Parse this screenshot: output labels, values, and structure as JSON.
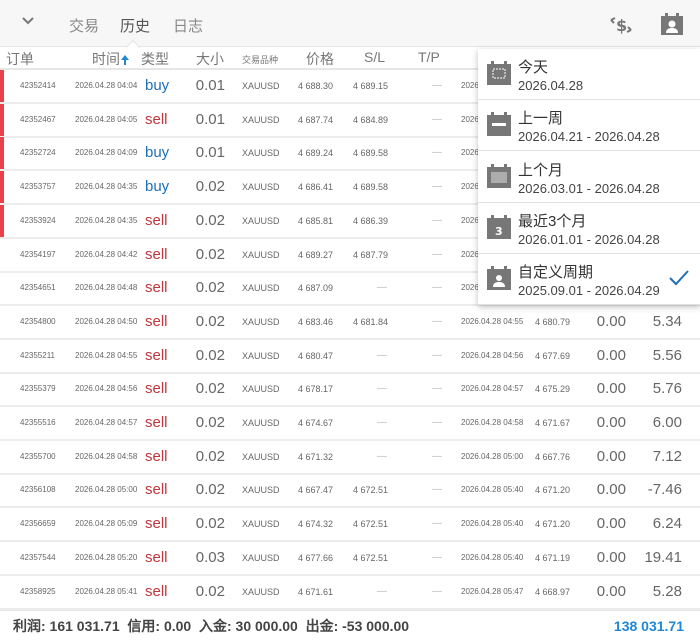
{
  "tabs": [
    {
      "label": "交易"
    },
    {
      "label": "历史",
      "active": true
    },
    {
      "label": "日志"
    }
  ],
  "icons": {
    "collapse": "chevron-down-icon",
    "exchange": "currency-exchange-icon",
    "period": "calendar-person-icon",
    "sort": "arrow-up-icon"
  },
  "columns": {
    "order": "订单",
    "time": "时间",
    "type": "类型",
    "size": "大小",
    "symbol": "交易品种",
    "price": "价格",
    "sl": "S/L",
    "tp": "T/P"
  },
  "colors": {
    "buy": "#1e6fb5",
    "sell": "#c0363c",
    "accent": "#1e88d6",
    "marker": "#e8414b"
  },
  "rows": [
    {
      "order": "42352414",
      "time": "2026.04.28 04:04",
      "type": "buy",
      "size": "0.01",
      "symbol": "XAUUSD",
      "price": "4 688.30",
      "sl": "4 689.15",
      "tp": "—",
      "close_time": "2026",
      "marked": true
    },
    {
      "order": "42352467",
      "time": "2026.04.28 04:05",
      "type": "sell",
      "size": "0.01",
      "symbol": "XAUUSD",
      "price": "4 687.74",
      "sl": "4 684.89",
      "tp": "—",
      "close_time": "2026",
      "marked": true
    },
    {
      "order": "42352724",
      "time": "2026.04.28 04:09",
      "type": "buy",
      "size": "0.01",
      "symbol": "XAUUSD",
      "price": "4 689.24",
      "sl": "4 689.58",
      "tp": "—",
      "close_time": "2026",
      "marked": true
    },
    {
      "order": "42353757",
      "time": "2026.04.28 04:35",
      "type": "buy",
      "size": "0.02",
      "symbol": "XAUUSD",
      "price": "4 686.41",
      "sl": "4 689.58",
      "tp": "—",
      "close_time": "2026",
      "marked": true
    },
    {
      "order": "42353924",
      "time": "2026.04.28 04:35",
      "type": "sell",
      "size": "0.02",
      "symbol": "XAUUSD",
      "price": "4 685.81",
      "sl": "4 686.39",
      "tp": "—",
      "close_time": "2026",
      "marked": true
    },
    {
      "order": "42354197",
      "time": "2026.04.28 04:42",
      "type": "sell",
      "size": "0.02",
      "symbol": "XAUUSD",
      "price": "4 689.27",
      "sl": "4 687.79",
      "tp": "—",
      "close_time": "2026"
    },
    {
      "order": "42354651",
      "time": "2026.04.28 04:48",
      "type": "sell",
      "size": "0.02",
      "symbol": "XAUUSD",
      "price": "4 687.09",
      "sl": "—",
      "tp": "—",
      "close_time": "2026"
    },
    {
      "order": "42354800",
      "time": "2026.04.28 04:50",
      "type": "sell",
      "size": "0.02",
      "symbol": "XAUUSD",
      "price": "4 683.46",
      "sl": "4 681.84",
      "tp": "—",
      "close_time": "2026.04.28 04:55",
      "close_price": "4 680.79",
      "swap": "0.00",
      "profit": "5.34"
    },
    {
      "order": "42355211",
      "time": "2026.04.28 04:55",
      "type": "sell",
      "size": "0.02",
      "symbol": "XAUUSD",
      "price": "4 680.47",
      "sl": "—",
      "tp": "—",
      "close_time": "2026.04.28 04:56",
      "close_price": "4 677.69",
      "swap": "0.00",
      "profit": "5.56"
    },
    {
      "order": "42355379",
      "time": "2026.04.28 04:56",
      "type": "sell",
      "size": "0.02",
      "symbol": "XAUUSD",
      "price": "4 678.17",
      "sl": "—",
      "tp": "—",
      "close_time": "2026.04.28 04:57",
      "close_price": "4 675.29",
      "swap": "0.00",
      "profit": "5.76"
    },
    {
      "order": "42355516",
      "time": "2026.04.28 04:57",
      "type": "sell",
      "size": "0.02",
      "symbol": "XAUUSD",
      "price": "4 674.67",
      "sl": "—",
      "tp": "—",
      "close_time": "2026.04.28 04:58",
      "close_price": "4 671.67",
      "swap": "0.00",
      "profit": "6.00"
    },
    {
      "order": "42355700",
      "time": "2026.04.28 04:58",
      "type": "sell",
      "size": "0.02",
      "symbol": "XAUUSD",
      "price": "4 671.32",
      "sl": "—",
      "tp": "—",
      "close_time": "2026.04.28 05:00",
      "close_price": "4 667.76",
      "swap": "0.00",
      "profit": "7.12"
    },
    {
      "order": "42356108",
      "time": "2026.04.28 05:00",
      "type": "sell",
      "size": "0.02",
      "symbol": "XAUUSD",
      "price": "4 667.47",
      "sl": "4 672.51",
      "tp": "—",
      "close_time": "2026.04.28 05:40",
      "close_price": "4 671.20",
      "swap": "0.00",
      "profit": "-7.46"
    },
    {
      "order": "42356659",
      "time": "2026.04.28 05:09",
      "type": "sell",
      "size": "0.02",
      "symbol": "XAUUSD",
      "price": "4 674.32",
      "sl": "4 672.51",
      "tp": "—",
      "close_time": "2026.04.28 05:40",
      "close_price": "4 671.20",
      "swap": "0.00",
      "profit": "6.24"
    },
    {
      "order": "42357544",
      "time": "2026.04.28 05:20",
      "type": "sell",
      "size": "0.03",
      "symbol": "XAUUSD",
      "price": "4 677.66",
      "sl": "4 672.51",
      "tp": "—",
      "close_time": "2026.04.28 05:40",
      "close_price": "4 671.19",
      "swap": "0.00",
      "profit": "19.41"
    },
    {
      "order": "42358925",
      "time": "2026.04.28 05:41",
      "type": "sell",
      "size": "0.02",
      "symbol": "XAUUSD",
      "price": "4 671.61",
      "sl": "—",
      "tp": "—",
      "close_time": "2026.04.28 05:47",
      "close_price": "4 668.97",
      "swap": "0.00",
      "profit": "5.28"
    }
  ],
  "footer": {
    "summary": "利润: 161 031.71  信用: 0.00  入金: 30 000.00  出金: -53 000.00",
    "balance": "138 031.71"
  },
  "period_menu": [
    {
      "label": "今天",
      "range": "2026.04.28",
      "icon": "calendar-day-icon"
    },
    {
      "label": "上一周",
      "range": "2026.04.21 - 2026.04.28",
      "icon": "calendar-week-icon"
    },
    {
      "label": "上个月",
      "range": "2026.03.01 - 2026.04.28",
      "icon": "calendar-month-icon"
    },
    {
      "label": "最近3个月",
      "range": "2026.01.01 - 2026.04.28",
      "icon": "calendar-3-icon"
    },
    {
      "label": "自定义周期",
      "range": "2025.09.01 - 2026.04.29",
      "icon": "calendar-person-icon",
      "selected": true
    }
  ]
}
